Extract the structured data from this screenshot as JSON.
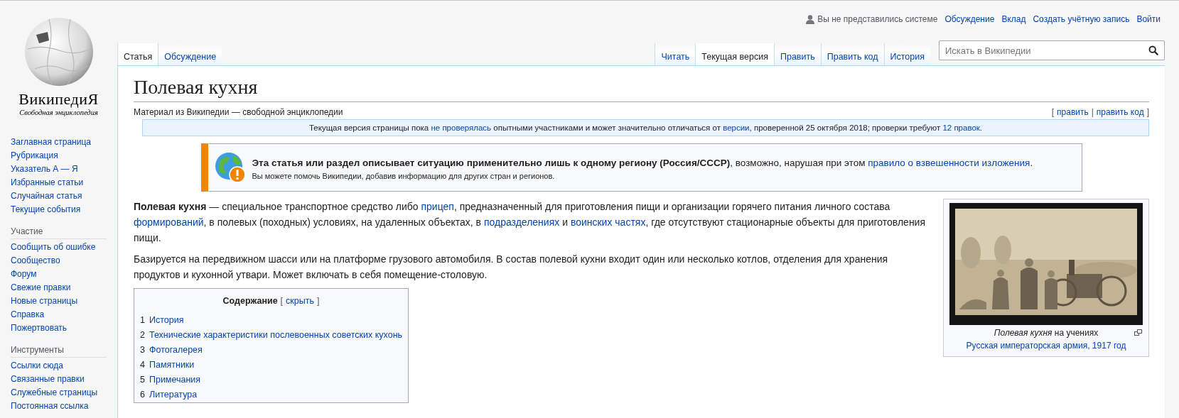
{
  "logo": {
    "wordmark": "ВикипедиЯ",
    "tagline": "Свободная энциклопедия"
  },
  "personal": {
    "status": "Вы не представились системе",
    "links": [
      "Обсуждение",
      "Вклад",
      "Создать учётную запись",
      "Войти"
    ]
  },
  "tabs_left": [
    {
      "label": "Статья",
      "selected": true
    },
    {
      "label": "Обсуждение",
      "selected": false
    }
  ],
  "tabs_right": [
    {
      "label": "Читать",
      "selected": false
    },
    {
      "label": "Текущая версия",
      "selected": true
    },
    {
      "label": "Править",
      "selected": false
    },
    {
      "label": "Править код",
      "selected": false
    },
    {
      "label": "История",
      "selected": false
    }
  ],
  "search": {
    "placeholder": "Искать в Википедии"
  },
  "sidebar": {
    "main": [
      "Заглавная страница",
      "Рубрикация",
      "Указатель А — Я",
      "Избранные статьи",
      "Случайная статья",
      "Текущие события"
    ],
    "sections": [
      {
        "heading": "Участие",
        "items": [
          "Сообщить об ошибке",
          "Сообщество",
          "Форум",
          "Свежие правки",
          "Новые страницы",
          "Справка",
          "Пожертвовать"
        ]
      },
      {
        "heading": "Инструменты",
        "items": [
          "Ссылки сюда",
          "Связанные правки",
          "Служебные страницы",
          "Постоянная ссылка"
        ]
      }
    ]
  },
  "article": {
    "title": "Полевая кухня",
    "site_sub": "Материал из Википедии — свободной энциклопедии",
    "edit_links": {
      "open": "[",
      "links": [
        "править",
        "править код"
      ],
      "separator": "|",
      "close": "]"
    },
    "flagged_notice": [
      {
        "kind": "text",
        "text": "Текущая версия страницы пока "
      },
      {
        "kind": "link",
        "text": "не проверялась"
      },
      {
        "kind": "text",
        "text": " опытными участниками и может значительно отличаться от "
      },
      {
        "kind": "link",
        "text": "версии"
      },
      {
        "kind": "text",
        "text": ", проверенной 25 октября 2018; проверки требуют "
      },
      {
        "kind": "link",
        "text": "12 правок"
      },
      {
        "kind": "text",
        "text": "."
      }
    ],
    "message_box": {
      "main": [
        {
          "kind": "bold",
          "text": "Эта статья или раздел описывает ситуацию применительно лишь к одному региону (Россия/СССР)"
        },
        {
          "kind": "text",
          "text": ", возможно, нарушая при этом "
        },
        {
          "kind": "link",
          "text": "правило о взвешенности изложения"
        },
        {
          "kind": "text",
          "text": "."
        }
      ],
      "note": "Вы можете помочь Википедии, добавив информацию для других стран и регионов."
    },
    "paragraphs": [
      [
        {
          "kind": "bold",
          "text": "Полевая кухня"
        },
        {
          "kind": "text",
          "text": " — специальное транспортное средство либо "
        },
        {
          "kind": "link",
          "text": "прицеп"
        },
        {
          "kind": "text",
          "text": ", предназначенный для приготовления пищи и организации горячего питания личного состава "
        },
        {
          "kind": "link",
          "text": "формирований"
        },
        {
          "kind": "text",
          "text": ", в полевых (походных) условиях, на удаленных объектах, в "
        },
        {
          "kind": "link",
          "text": "подразделениях"
        },
        {
          "kind": "text",
          "text": " и "
        },
        {
          "kind": "link",
          "text": "воинских частях"
        },
        {
          "kind": "text",
          "text": ", где отсутствуют стационарные объекты для приготовления пищи."
        }
      ],
      [
        {
          "kind": "text",
          "text": "Базируется на передвижном шасси или на платформе грузового автомобиля. В состав полевой кухни входит один или несколько котлов, отделения для хранения продуктов и кухонной утвари. Может включать в себя помещение-столовую."
        }
      ]
    ],
    "toc": {
      "title": "Содержание",
      "toggle": {
        "open": "[",
        "link": "скрыть",
        "close": "]"
      },
      "items": [
        {
          "number": "1",
          "text": "История"
        },
        {
          "number": "2",
          "text": "Технические характеристики послевоенных советских кухонь"
        },
        {
          "number": "3",
          "text": "Фотогалерея"
        },
        {
          "number": "4",
          "text": "Памятники"
        },
        {
          "number": "5",
          "text": "Примечания"
        },
        {
          "number": "6",
          "text": "Литература"
        }
      ]
    },
    "thumb": {
      "caption": "*Полевая кухня* на учениях",
      "caption_link": "Русская императорская армия, 1917 год"
    }
  }
}
